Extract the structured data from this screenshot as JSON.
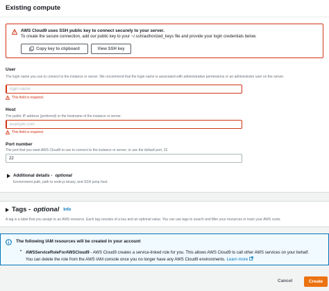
{
  "compute": {
    "title": "Existing compute",
    "warning": {
      "title": "AWS Cloud9 uses SSH public key to connect securely to your server.",
      "text": "To create the secure connection, add our public key to your ~/.ssh/authorized_keys file and provide your login credentials below.",
      "copy_button": "Copy key to clipboard",
      "view_button": "View SSH key"
    },
    "user": {
      "label": "User",
      "description": "The login name you use to connect to the instance or server. We recommend that the login name is associated with administrative permissions or an administrator user on the server.",
      "placeholder": "login-name",
      "error": "This field is required."
    },
    "host": {
      "label": "Host",
      "description": "The public IP address (preferred) or the hostname of the instance or server.",
      "placeholder": "example.com",
      "error": "This field is required."
    },
    "port": {
      "label": "Port number",
      "description": "The port that you want AWS Cloud9 to use to connect to the instance or server, or use the default port, 22.",
      "value": "22"
    },
    "details": {
      "title": "Additional details -",
      "optional": "optional",
      "description": "Environment path, path to node.js binary, and SSH jump host."
    }
  },
  "tags": {
    "title": "Tags -",
    "optional": "optional",
    "info": "Info",
    "description": "A tag is a label that you assign to an AWS resource. Each tag consists of a key and an optional value. You can use tags to search and filter your resources or track your AWS costs."
  },
  "iam": {
    "title": "The following IAM resources will be created in your account",
    "role_name": "AWSServiceRoleForAWSCloud9",
    "text_line1": " - AWS Cloud9 creates a service-linked role for you. This allows AWS Cloud9 to call other AWS services on your behalf.",
    "text_line2": "You can delete the role from the AWS IAM console once you no longer have any AWS Cloud9 environments.",
    "learn_more": "Learn more"
  },
  "footer": {
    "cancel": "Cancel",
    "create": "Create"
  },
  "colors": {
    "error": "#d13212",
    "primary": "#ec7211",
    "info": "#0073bb"
  }
}
